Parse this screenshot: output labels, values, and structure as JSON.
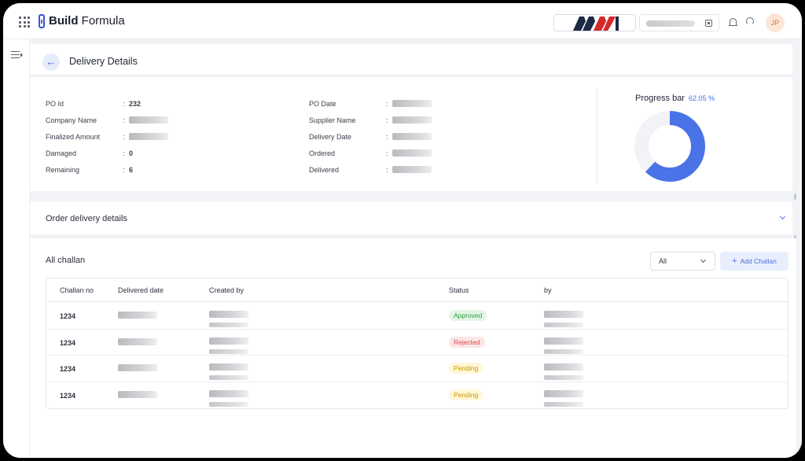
{
  "app": {
    "brand_bold": "Build",
    "brand_light": "Formula"
  },
  "topbar": {
    "avatar_initials": "JP",
    "brand_logo_text": "MV"
  },
  "page": {
    "title": "Delivery Details"
  },
  "info": {
    "left": [
      {
        "label": "PO Id",
        "value": "232",
        "blurred": false
      },
      {
        "label": "Company Name",
        "value": "",
        "blurred": true
      },
      {
        "label": "Finalized Amount",
        "value": "",
        "blurred": true
      },
      {
        "label": "Damaged",
        "value": "0",
        "blurred": false
      },
      {
        "label": "Remaining",
        "value": "6",
        "blurred": false
      }
    ],
    "right": [
      {
        "label": "PO Date",
        "value": "",
        "blurred": true
      },
      {
        "label": "Supplier Name",
        "value": "",
        "blurred": true
      },
      {
        "label": "Delivery Date",
        "value": "",
        "blurred": true
      },
      {
        "label": "Ordered",
        "value": "",
        "blurred": true
      },
      {
        "label": "Delivered",
        "value": "",
        "blurred": true
      }
    ],
    "separator": ":"
  },
  "progress": {
    "label": "Progress bar",
    "percent_text": "62.05 %",
    "fraction": 0.6205,
    "fill_color": "#4a73e8",
    "track_color": "#f1f3f6"
  },
  "order_delivery": {
    "title": "Order delivery details"
  },
  "challan": {
    "title": "All challan",
    "filter_value": "All",
    "add_button": "Add Challan",
    "columns": [
      "Challan no",
      "Delivered date",
      "Created by",
      "Status",
      "by"
    ],
    "rows": [
      {
        "challan_no": "1234",
        "status": "Approved",
        "status_type": "approved"
      },
      {
        "challan_no": "1234",
        "status": "Rejected",
        "status_type": "rejected"
      },
      {
        "challan_no": "1234",
        "status": "Pending",
        "status_type": "pending"
      },
      {
        "challan_no": "1234",
        "status": "Pending",
        "status_type": "pending"
      }
    ]
  },
  "colors": {
    "accent": "#4a73e8",
    "approved": "#2f9e44",
    "rejected": "#d9484c",
    "pending": "#c99700"
  }
}
